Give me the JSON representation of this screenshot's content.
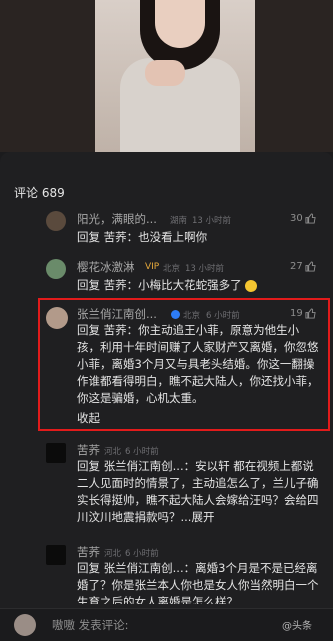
{
  "comments_count_label": "评论 689",
  "comments": [
    {
      "user": "阳光，满眼的...",
      "location": "湖南",
      "time": "13 小时前",
      "likes": "30",
      "reply_kw": "回复",
      "mention": "苦荞",
      "text": "：也没看上啊你"
    },
    {
      "user": "樱花冰激淋",
      "vip": "VIP",
      "location": "北京",
      "time": "13 小时前",
      "likes": "27",
      "reply_kw": "回复",
      "mention": "苦荞",
      "text": "：小梅比大花蛇强多了"
    },
    {
      "user": "张兰俏江南创...",
      "location": "北京",
      "time": "6 小时前",
      "likes": "19",
      "reply_kw": "回复",
      "mention": "苦荞",
      "text": "：你主动追王小菲，原意为他生小孩，利用十年时间赚了人家财产又离婚，你忽悠小菲，离婚3个月又与具老头结婚。你这一翻操作谁都看得明白，瞧不起大陆人，你还找小菲，你这是骗婚，心机太重。",
      "fold": "收起"
    },
    {
      "user": "苦荞",
      "location": "河北",
      "time": "6 小时前",
      "reply_kw": "回复",
      "mention": "张兰俏江南创...",
      "text": "：安以轩 都在视频上都说二人见面时的情景了，主动追怎么了，兰儿子确实长得挺帅，瞧不起大陆人会嫁给汪吗？会给四川汶川地震捐款吗？...",
      "expand": "展开"
    },
    {
      "user": "苦荞",
      "location": "河北",
      "time": "6 小时前",
      "reply_kw": "回复",
      "mention": "张兰俏江南创...",
      "text": "：离婚3个月是不是已经离婚了？你是张兰本人你也是女人你当然明白一个生育之后的女人离婚是怎么样？"
    }
  ],
  "input_placeholder": "嗷嗷 发表评论:",
  "watermark": "@头条"
}
